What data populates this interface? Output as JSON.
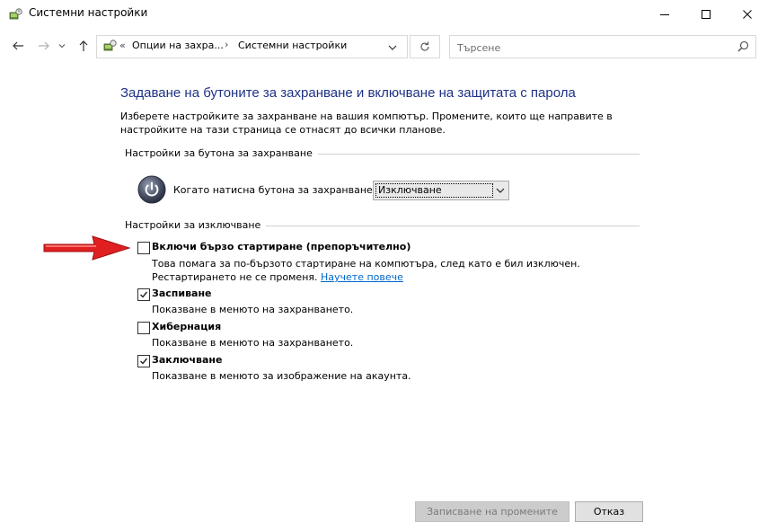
{
  "window": {
    "title": "Системни настройки",
    "icon": "power-options-icon",
    "controls": {
      "minimize": "minimize-icon",
      "maximize": "maximize-icon",
      "close": "close-icon"
    }
  },
  "nav": {
    "back": "back-arrow-icon",
    "forward": "forward-arrow-icon",
    "recent": "chevron-down-icon",
    "up": "up-arrow-icon"
  },
  "address": {
    "overflow": "«",
    "crumbs": [
      "Опции на захра...",
      "Системни настройки"
    ]
  },
  "search": {
    "placeholder": "Търсене"
  },
  "page": {
    "heading": "Задаване на бутоните за захранване и включване на защитата с парола",
    "description": "Изберете настройките за захранване на вашия компютър. Промените, които ще направите в настройките на тази страница се отнасят до всички планове."
  },
  "power_button_group": {
    "label": "Настройки за бутона за захранване",
    "row_label": "Когато натисна бутона за захранване:",
    "selected": "Изключване"
  },
  "shutdown_group": {
    "label": "Настройки за изключване",
    "options": [
      {
        "title": "Включи бързо стартиране (препоръчително)",
        "desc": "Това помага за по-бързото стартиране на компютъра, след като е бил изключен. Рестартирането не се променя.",
        "link": "Научете повече",
        "checked": false
      },
      {
        "title": "Заспиване",
        "desc": "Показване в менюто на захранването.",
        "checked": true
      },
      {
        "title": "Хибернация",
        "desc": "Показване в менюто на захранването.",
        "checked": false
      },
      {
        "title": "Заключване",
        "desc": "Показване в менюто за изображение на акаунта.",
        "checked": true
      }
    ]
  },
  "footer": {
    "save_label": "Записване на промените",
    "cancel_label": "Отказ"
  },
  "colors": {
    "heading": "#1e3287",
    "link": "#0066cc",
    "annotation_arrow": "#e02020"
  }
}
